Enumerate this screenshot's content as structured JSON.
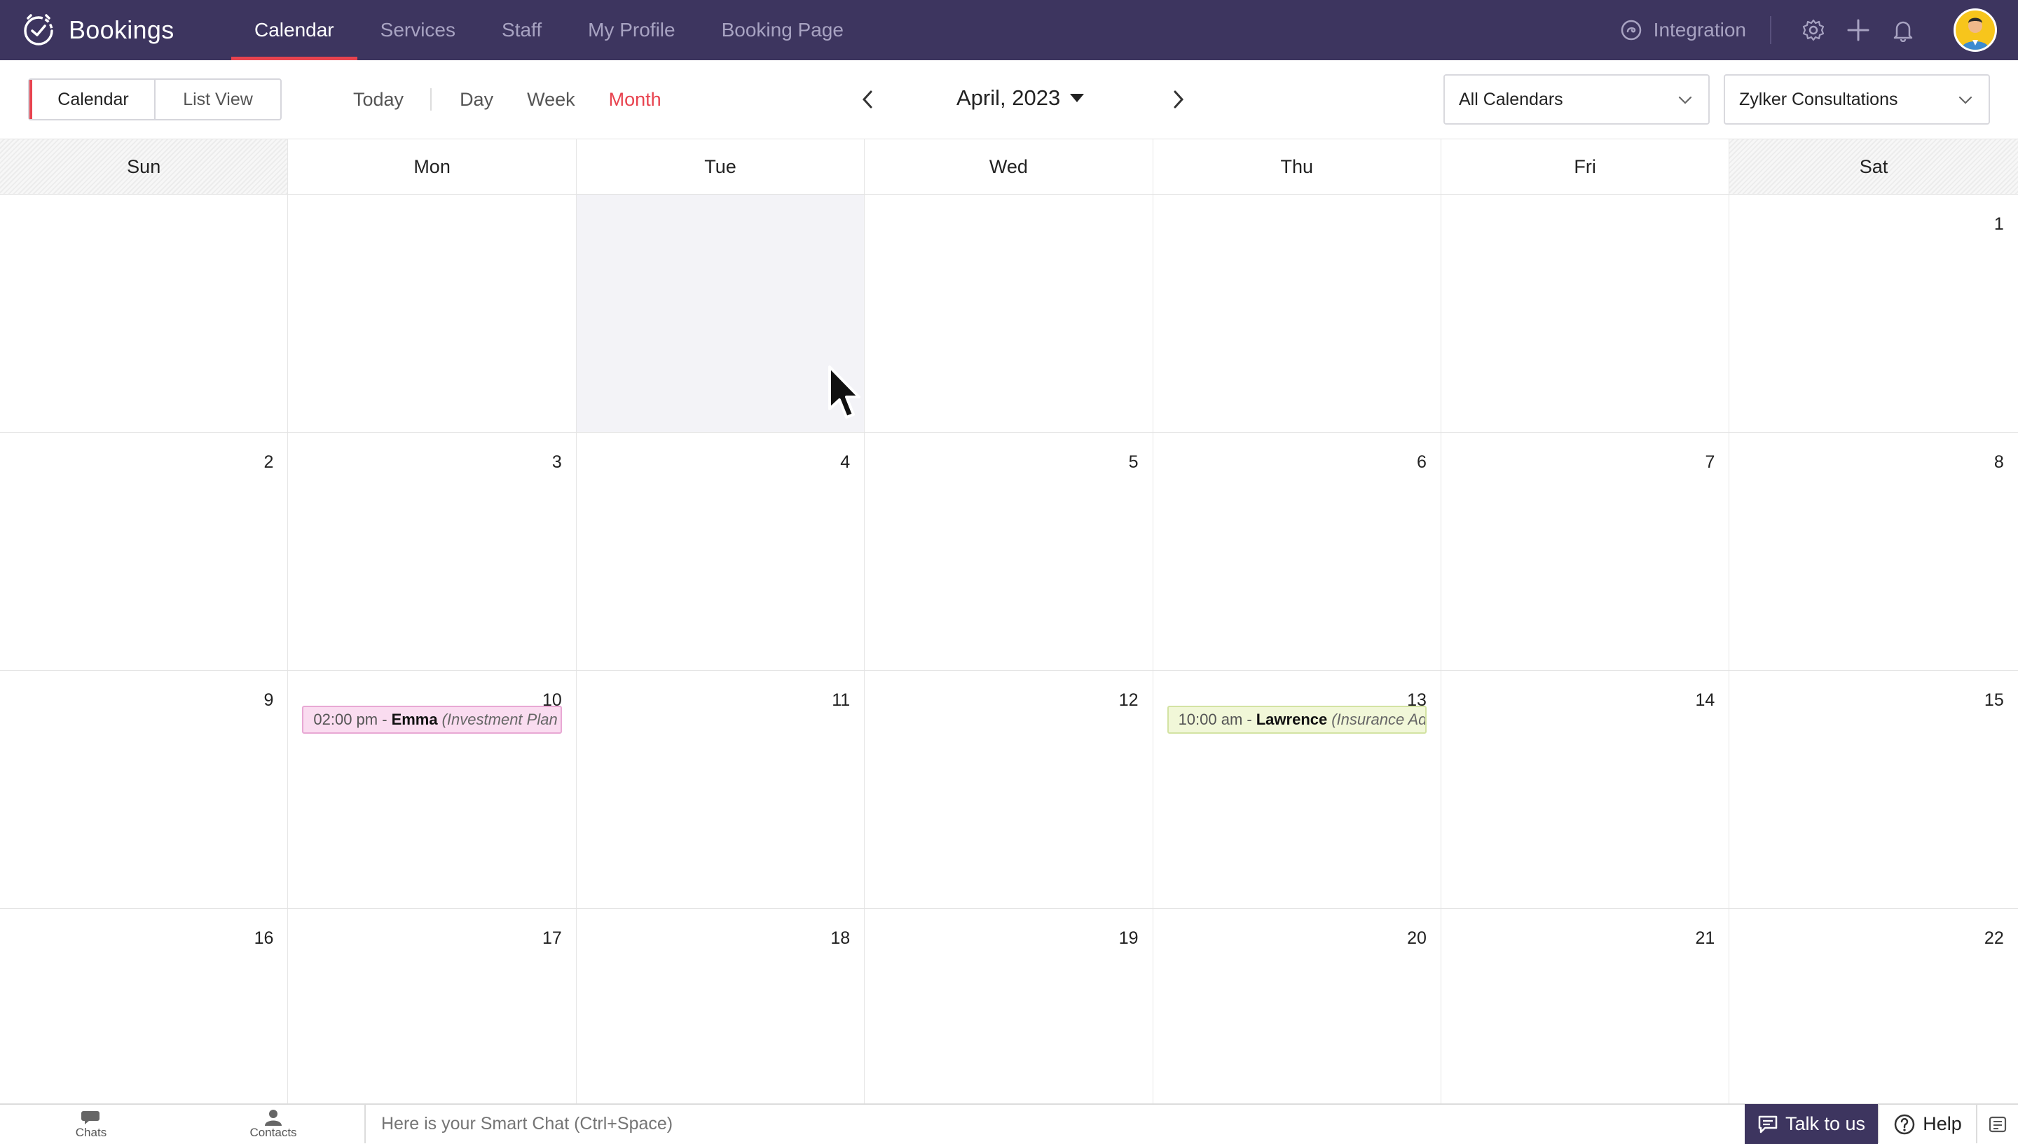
{
  "app": {
    "name": "Bookings"
  },
  "nav": {
    "tabs": [
      {
        "label": "Calendar",
        "active": true
      },
      {
        "label": "Services"
      },
      {
        "label": "Staff"
      },
      {
        "label": "My Profile"
      },
      {
        "label": "Booking Page"
      }
    ],
    "integration_label": "Integration",
    "icons": [
      "gear-icon",
      "plus-icon",
      "bell-icon"
    ]
  },
  "toolbar": {
    "view_toggle": {
      "calendar": "Calendar",
      "list": "List View"
    },
    "range": {
      "today": "Today",
      "day": "Day",
      "week": "Week",
      "month": "Month",
      "active": "Month"
    },
    "month_label": "April, 2023",
    "calendar_filter": "All Calendars",
    "workspace_filter": "Zylker Consultations"
  },
  "calendar": {
    "days_of_week": [
      "Sun",
      "Mon",
      "Tue",
      "Wed",
      "Thu",
      "Fri",
      "Sat"
    ],
    "weeks": [
      [
        "",
        "",
        "",
        "",
        "",
        "",
        "1"
      ],
      [
        "2",
        "3",
        "4",
        "5",
        "6",
        "7",
        "8"
      ],
      [
        "9",
        "10",
        "11",
        "12",
        "13",
        "14",
        "15"
      ],
      [
        "16",
        "17",
        "18",
        "19",
        "20",
        "21",
        "22"
      ]
    ],
    "events": [
      {
        "day": "10",
        "time": "02:00 pm -",
        "name": "Emma",
        "service": "(Investment Plan",
        "color": "#fadcf0"
      },
      {
        "day": "13",
        "time": "10:00 am -",
        "name": "Lawrence",
        "service": "(Insurance Ad",
        "color": "#f1f7d8"
      }
    ]
  },
  "bottombar": {
    "chats": "Chats",
    "contacts": "Contacts",
    "smart_chat_placeholder": "Here is your Smart Chat (Ctrl+Space)",
    "talk": "Talk to us",
    "help": "Help"
  },
  "colors": {
    "nav_bg": "#3d355f",
    "accent": "#e8434f"
  }
}
